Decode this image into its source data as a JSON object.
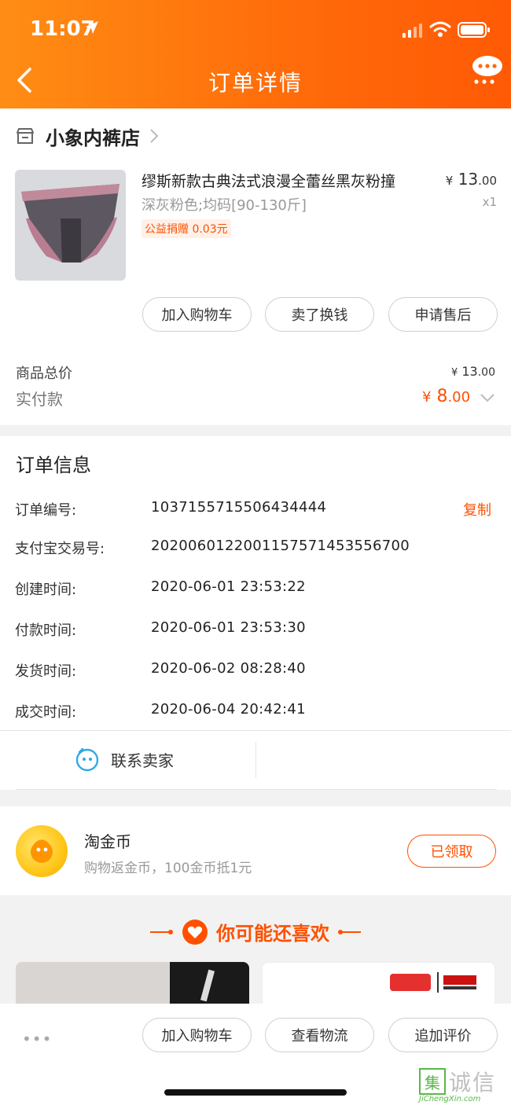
{
  "status_bar": {
    "time": "11:07"
  },
  "header": {
    "title": "订单详情"
  },
  "shop": {
    "name": "小象内裤店"
  },
  "product": {
    "title": "缪斯新款古典法式浪漫全蕾丝黑灰粉撞",
    "sku": "深灰粉色;均码[90-130斤]",
    "charity_tag": "公益捐赠 0.03元",
    "price_symbol": "¥",
    "price_int": "13",
    "price_dec": ".00",
    "qty": "x1"
  },
  "actions": {
    "add_cart": "加入购物车",
    "sell_cash": "卖了换钱",
    "after_sale": "申请售后"
  },
  "totals": {
    "goods_total_label": "商品总价",
    "goods_total_symbol": "¥",
    "goods_total_int": "13",
    "goods_total_dec": ".00",
    "paid_label": "实付款",
    "paid_symbol": "¥",
    "paid_int": "8",
    "paid_dec": ".00"
  },
  "order_info": {
    "title": "订单信息",
    "copy_label": "复制",
    "rows": [
      {
        "label": "订单编号:",
        "value": "1037155715506434444"
      },
      {
        "label": "支付宝交易号:",
        "value": "2020060122001157571453556700"
      },
      {
        "label": "创建时间:",
        "value": "2020-06-01 23:53:22"
      },
      {
        "label": "付款时间:",
        "value": "2020-06-01 23:53:30"
      },
      {
        "label": "发货时间:",
        "value": "2020-06-02 08:28:40"
      },
      {
        "label": "成交时间:",
        "value": "2020-06-04 20:42:41"
      }
    ]
  },
  "contact": {
    "label": "联系卖家"
  },
  "coins": {
    "title": "淘金币",
    "subtitle": "购物返金币，100金币抵1元",
    "button": "已领取"
  },
  "recommend": {
    "title": "你可能还喜欢"
  },
  "bottom_bar": {
    "more": "•••",
    "add_cart": "加入购物车",
    "logistics": "查看物流",
    "review": "追加评价"
  },
  "watermark": {
    "glyph": "集",
    "text": "诚信",
    "url": "JiChengXin.com"
  },
  "colors": {
    "accent": "#ff5000",
    "header_start": "#ff8d14",
    "header_end": "#ff5a05"
  }
}
